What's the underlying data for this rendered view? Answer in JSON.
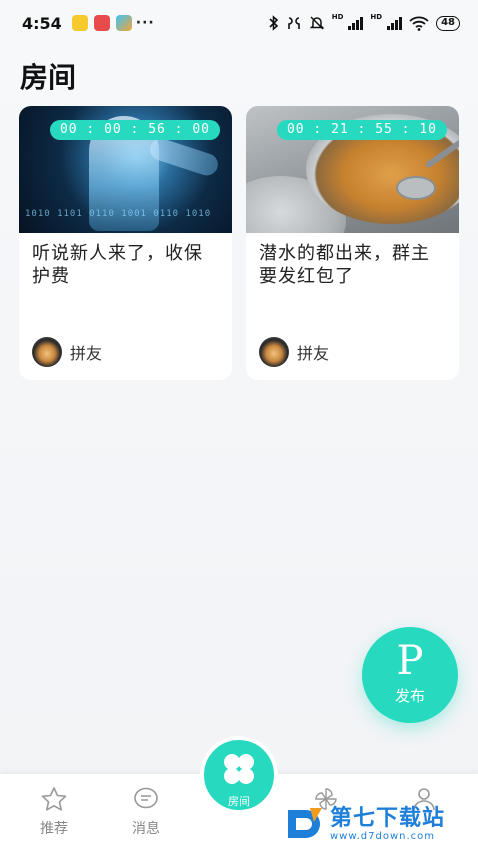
{
  "status_bar": {
    "time": "4:54",
    "more": "···",
    "battery": "48",
    "hd1": "HD",
    "hd2": "HD"
  },
  "page": {
    "title": "房间"
  },
  "rooms": [
    {
      "timer": "00 : 00 : 56 : 00",
      "title": "听说新人来了，收保护费",
      "user": "拼友",
      "image": "cyber-body-image"
    },
    {
      "timer": "00 : 21 : 55 : 10",
      "title": "潜水的都出来，群主要发红包了",
      "user": "拼友",
      "image": "cooking-pot-image"
    }
  ],
  "fab": {
    "letter": "P",
    "label": "发布"
  },
  "tabbar": {
    "items": [
      {
        "label": "推荐",
        "icon": "star-icon"
      },
      {
        "label": "消息",
        "icon": "message-icon"
      },
      {
        "label": "房间",
        "icon": "clover-icon"
      },
      {
        "label": "",
        "icon": "pinwheel-icon"
      },
      {
        "label": "",
        "icon": "person-icon"
      }
    ]
  },
  "watermark": {
    "cn": "第七下载站",
    "url": "www.d7down.com"
  },
  "colors": {
    "accent": "#27d9bf",
    "watermark": "#1e7fd8"
  }
}
